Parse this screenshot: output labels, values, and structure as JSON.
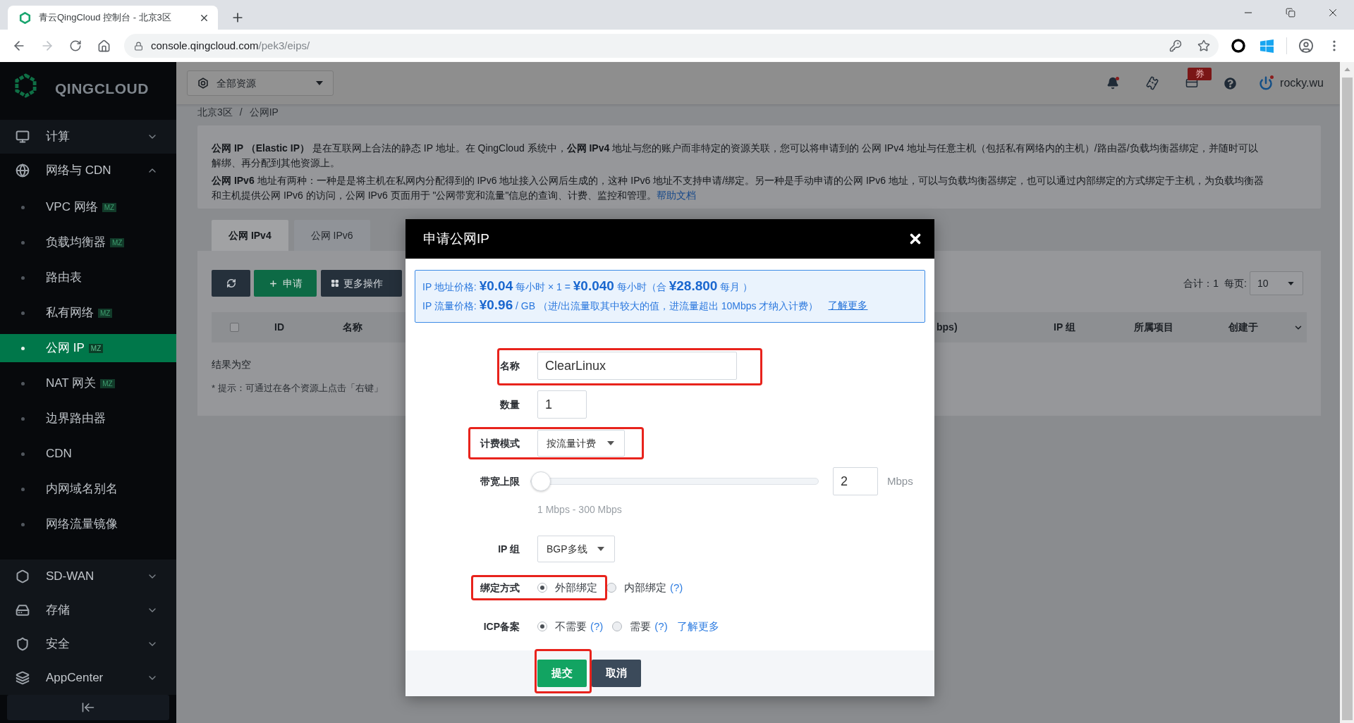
{
  "browser": {
    "tab_title": "青云QingCloud 控制台 - 北京3区",
    "url_host": "console.qingcloud.com",
    "url_path": "/pek3/eips/",
    "forward_disabled": true
  },
  "sidebar": {
    "logo": "QINGCLOUD",
    "groups": [
      {
        "label": "计算",
        "expanded": false
      },
      {
        "label": "网络与 CDN",
        "expanded": true,
        "children": [
          {
            "label": "VPC 网络",
            "badge": "MZ",
            "selected": false
          },
          {
            "label": "负载均衡器",
            "badge": "MZ",
            "selected": false
          },
          {
            "label": "路由表",
            "selected": false
          },
          {
            "label": "私有网络",
            "badge": "MZ",
            "selected": false
          },
          {
            "label": "公网 IP",
            "badge": "MZ",
            "selected": true
          },
          {
            "label": "NAT 网关",
            "badge": "MZ",
            "selected": false
          },
          {
            "label": "边界路由器",
            "selected": false
          },
          {
            "label": "CDN",
            "selected": false
          },
          {
            "label": "内网域名别名",
            "selected": false
          },
          {
            "label": "网络流量镜像",
            "selected": false
          }
        ]
      },
      {
        "label": "SD-WAN",
        "expanded": false
      },
      {
        "label": "存储",
        "expanded": false
      },
      {
        "label": "安全",
        "expanded": false
      },
      {
        "label": "AppCenter",
        "expanded": false
      }
    ]
  },
  "header": {
    "resource_select": "全部资源",
    "coupon_badge": "券",
    "username": "rocky.wu"
  },
  "breadcrumb": {
    "items": [
      "北京3区",
      "公网IP"
    ],
    "separator": "/"
  },
  "description": {
    "paragraphs": [
      {
        "text": "**公网 IP （Elastic IP）** 是在互联网上合法的静态 IP 地址。在 QingCloud 系统中，**公网 IPv4** 地址与您的账户而非特定的资源关联，您可以将申请到的 公网 IPv4 地址与任意主机（包括私有网络内的主机）/路由器/负载均衡器绑定，并随时可以解绑、再分配到其他资源上。"
      },
      {
        "text": "**公网 IPv6** 地址有两种：一种是是将主机在私网内分配得到的 IPv6 地址接入公网后生成的，这种 IPv6 地址不支持申请/绑定。另一种是手动申请的公网 IPv6 地址，可以与负载均衡器绑定，也可以通过内部绑定的方式绑定于主机，为负载均衡器和主机提供公网 IPv6 的访问，公网 IPv6 页面用于 \"公网带宽和流量\"信息的查询、计费、监控和管理。",
        "link": "帮助文档"
      }
    ]
  },
  "tabs": [
    {
      "label": "公网 IPv4",
      "selected": true
    },
    {
      "label": "公网 IPv6",
      "selected": false
    }
  ],
  "toolbar": {
    "buttons": [
      {
        "kind": "refresh"
      },
      {
        "kind": "create",
        "label": "申请"
      },
      {
        "kind": "more",
        "label": "更多操作"
      }
    ],
    "total": "合计：1",
    "page_size_label": "每页:",
    "page_size": "10"
  },
  "table": {
    "select_all_checked": false,
    "columns": [
      "ID",
      "名称",
      "bps)",
      "IP 组",
      "所属项目",
      "创建于"
    ],
    "empty_text": "结果为空",
    "tip": "* 提示：可通过在各个资源上点击「右键」"
  },
  "dialog": {
    "title": "申请公网IP",
    "pricing": [
      {
        "text": "IP 地址价格: **¥0.04** 每小时 × 1 = **¥0.040** 每小时（合 **¥28.800** 每月 ）"
      },
      {
        "text": "IP 流量价格: **¥0.96** / GB （进/出流量取其中较大的值，进流量超出 10Mbps 才纳入计费）",
        "link": "了解更多"
      }
    ],
    "fields": [
      {
        "kind": "text",
        "label": "名称",
        "value": "ClearLinux",
        "highlighted": true
      },
      {
        "kind": "text",
        "label": "数量",
        "value": "1",
        "highlighted": false
      },
      {
        "kind": "select",
        "label": "计费模式",
        "value": "按流量计费",
        "highlighted": true
      },
      {
        "kind": "slider",
        "label": "带宽上限",
        "level": 0.003,
        "value": "2",
        "unit": "Mbps",
        "hint": "1 Mbps - 300 Mbps",
        "highlighted": false
      },
      {
        "kind": "select",
        "label": "IP 组",
        "value": "BGP多线",
        "highlighted": false
      },
      {
        "kind": "radio",
        "label": "绑定方式",
        "options": [
          {
            "label": "外部绑定",
            "selected": true
          },
          {
            "label": "内部绑定",
            "help": "(?)",
            "selected": false
          }
        ],
        "highlighted": true
      },
      {
        "kind": "radio",
        "label": "ICP备案",
        "options": [
          {
            "label": "不需要",
            "help": "(?)",
            "selected": true
          },
          {
            "label": "需要",
            "help": "(?)",
            "selected": false
          }
        ],
        "link": "了解更多",
        "highlighted": false
      }
    ],
    "buttons": [
      {
        "kind": "primary",
        "label": "提交",
        "highlighted": true
      },
      {
        "kind": "secondary",
        "label": "取消",
        "highlighted": false
      }
    ]
  }
}
